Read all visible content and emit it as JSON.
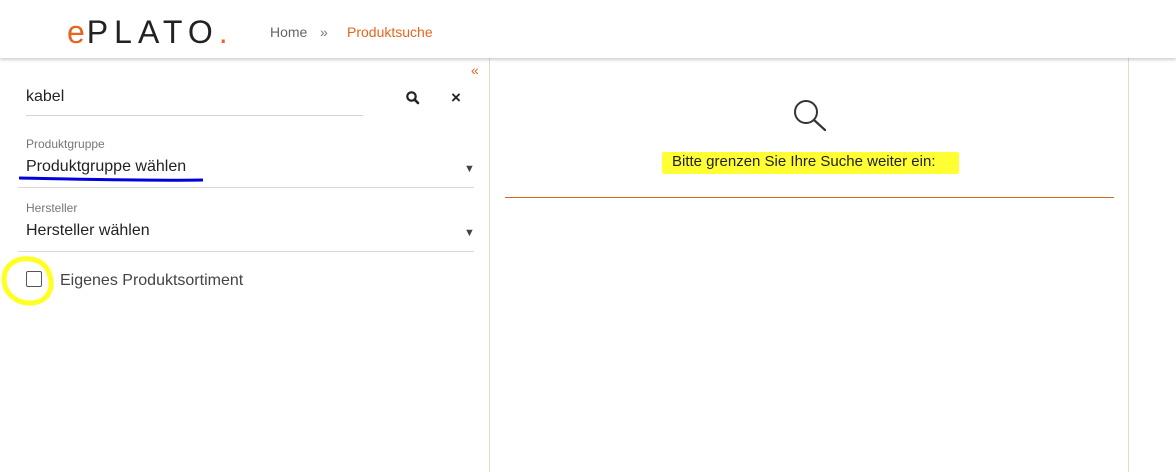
{
  "header": {
    "logo": {
      "e": "e",
      "rest": "PLATO",
      "dot": "."
    },
    "breadcrumb": {
      "home": "Home",
      "separator": "»",
      "current": "Produktsuche"
    }
  },
  "sidebar": {
    "collapse_glyph": "«",
    "search": {
      "value": "kabel",
      "search_icon": "search-icon",
      "clear_glyph": "×"
    },
    "product_group": {
      "label": "Produktgruppe",
      "value": "Produktgruppe wählen",
      "caret": "▼"
    },
    "manufacturer": {
      "label": "Hersteller",
      "value": "Hersteller wählen",
      "caret": "▼"
    },
    "own_assortment": {
      "label": "Eigenes Produktsortiment",
      "checked": false
    }
  },
  "main": {
    "icon": "magnifier-icon",
    "hint": "Bitte grenzen Sie Ihre Suche weiter ein:"
  },
  "colors": {
    "accent": "#e8641e",
    "highlight": "#ffff33",
    "annotation_blue": "#0000dd"
  }
}
